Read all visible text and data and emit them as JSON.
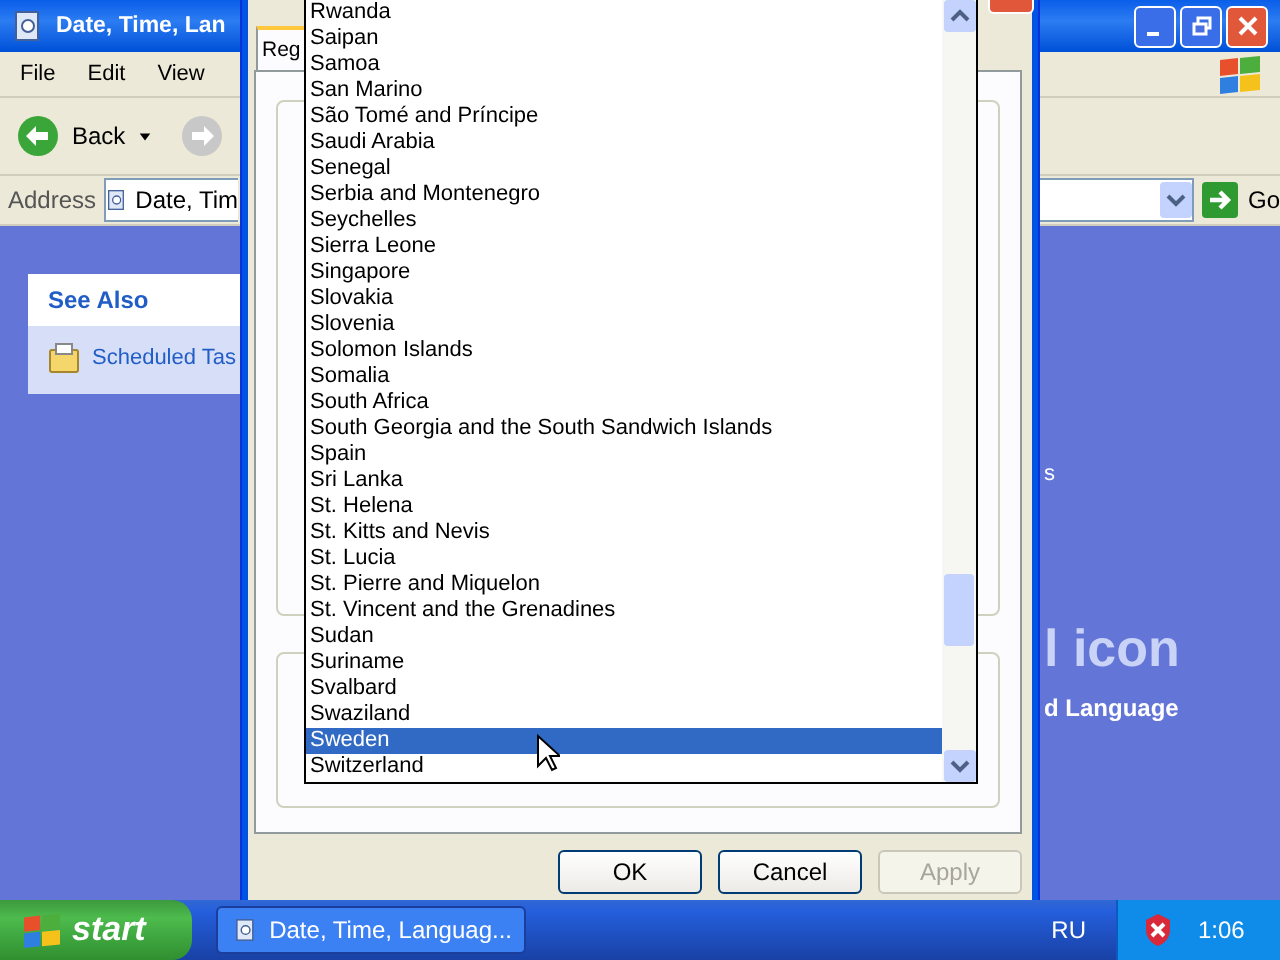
{
  "explorer": {
    "title": "Date, Time, Lan",
    "menu": [
      "File",
      "Edit",
      "View"
    ],
    "back_label": "Back",
    "address_label": "Address",
    "address_value": "Date, Tim",
    "go_label": "Go",
    "see_also": {
      "title": "See Also",
      "items": [
        "Scheduled Tas"
      ]
    },
    "content_texts": [
      {
        "kind": "small",
        "text": "s"
      },
      {
        "kind": "big",
        "text": "l icon"
      },
      {
        "kind": "bold",
        "text": "d Language"
      }
    ]
  },
  "dialog": {
    "tabs": [
      {
        "label": "Reg",
        "selected": true
      }
    ],
    "buttons": [
      {
        "label": "OK",
        "disabled": false
      },
      {
        "label": "Cancel",
        "disabled": false
      },
      {
        "label": "Apply",
        "disabled": true
      }
    ]
  },
  "dropdown": {
    "items": [
      {
        "label": "Rwanda",
        "selected": false
      },
      {
        "label": "Saipan",
        "selected": false
      },
      {
        "label": "Samoa",
        "selected": false
      },
      {
        "label": "San Marino",
        "selected": false
      },
      {
        "label": "São Tomé and Príncipe",
        "selected": false
      },
      {
        "label": "Saudi Arabia",
        "selected": false
      },
      {
        "label": "Senegal",
        "selected": false
      },
      {
        "label": "Serbia and Montenegro",
        "selected": false
      },
      {
        "label": "Seychelles",
        "selected": false
      },
      {
        "label": "Sierra Leone",
        "selected": false
      },
      {
        "label": "Singapore",
        "selected": false
      },
      {
        "label": "Slovakia",
        "selected": false
      },
      {
        "label": "Slovenia",
        "selected": false
      },
      {
        "label": "Solomon Islands",
        "selected": false
      },
      {
        "label": "Somalia",
        "selected": false
      },
      {
        "label": "South Africa",
        "selected": false
      },
      {
        "label": "South Georgia and the South Sandwich Islands",
        "selected": false
      },
      {
        "label": "Spain",
        "selected": false
      },
      {
        "label": "Sri Lanka",
        "selected": false
      },
      {
        "label": "St. Helena",
        "selected": false
      },
      {
        "label": "St. Kitts and Nevis",
        "selected": false
      },
      {
        "label": "St. Lucia",
        "selected": false
      },
      {
        "label": "St. Pierre and Miquelon",
        "selected": false
      },
      {
        "label": "St. Vincent and the Grenadines",
        "selected": false
      },
      {
        "label": "Sudan",
        "selected": false
      },
      {
        "label": "Suriname",
        "selected": false
      },
      {
        "label": "Svalbard",
        "selected": false
      },
      {
        "label": "Swaziland",
        "selected": false
      },
      {
        "label": "Sweden",
        "selected": true
      },
      {
        "label": "Switzerland",
        "selected": false
      }
    ]
  },
  "taskbar": {
    "start_label": "start",
    "tasks": [
      {
        "label": "Date, Time, Languag...",
        "selected": false
      }
    ],
    "language": "RU",
    "clock": "1:06"
  }
}
